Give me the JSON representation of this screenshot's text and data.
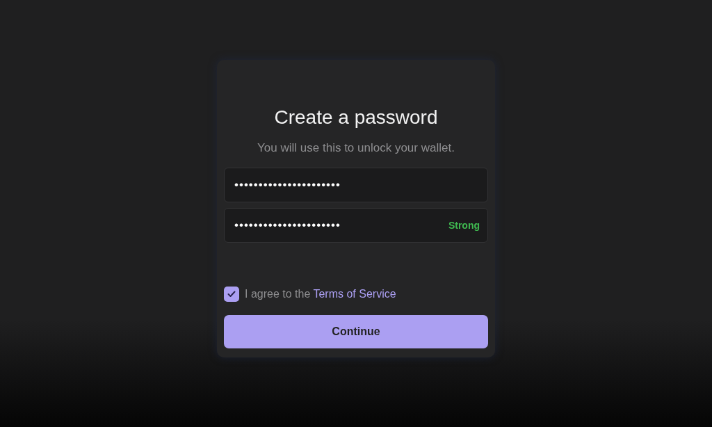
{
  "title": "Create a password",
  "subtitle": "You will use this to unlock your wallet.",
  "fields": [
    {
      "value": "••••••••••••••••••••••"
    },
    {
      "value": "••••••••••••••••••••••",
      "strength": "Strong"
    }
  ],
  "agree": {
    "checked": true,
    "text": "I agree to the",
    "link": "Terms of Service"
  },
  "continue_button": {
    "label": "Continue",
    "disabled": false
  }
}
